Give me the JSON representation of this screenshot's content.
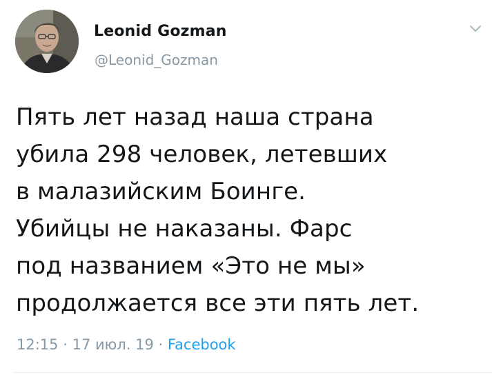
{
  "author": {
    "name": "Leonid Gozman",
    "handle": "@Leonid_Gozman",
    "avatar_icon": "user-photo"
  },
  "menu": {
    "icon": "chevron-down-icon"
  },
  "tweet": {
    "lines": [
      "Пять лет назад наша страна",
      "убила 298 человек, летевших",
      "в малазийским Боинге.",
      "Убийцы не наказаны. Фарс",
      "под названием «Это не мы»",
      "продолжается все эти пять лет."
    ]
  },
  "meta": {
    "time": "12:15",
    "separator": "·",
    "date": "17 июл. 19",
    "source": "Facebook"
  },
  "colors": {
    "text": "#14171a",
    "secondary": "#8899a6",
    "link": "#1da1f2"
  }
}
